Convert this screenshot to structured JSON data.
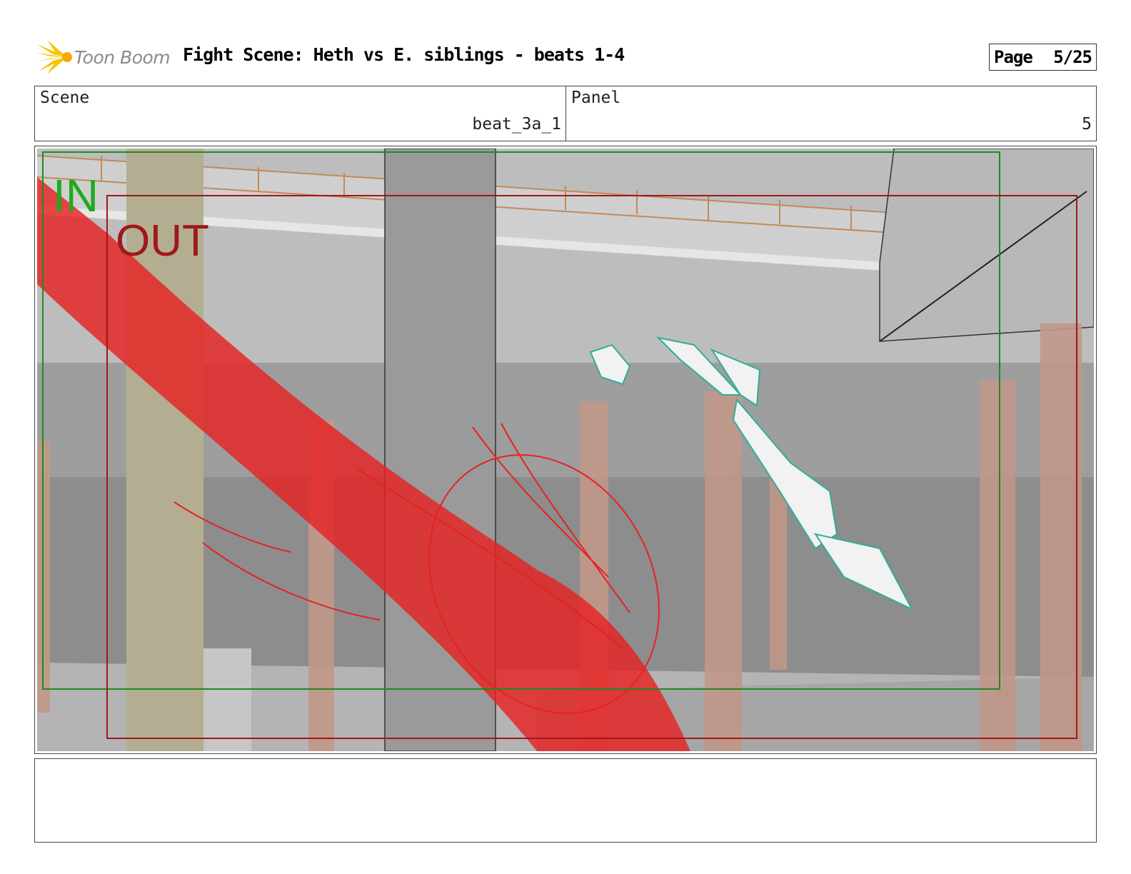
{
  "header": {
    "logo_text": "Toon Boom",
    "title": "Fight Scene: Heth vs E. siblings - beats 1-4",
    "page_label": "Page",
    "page_number": "5/25"
  },
  "info": {
    "scene_label": "Scene",
    "scene_value": "beat_3a_1",
    "panel_label": "Panel",
    "panel_value": "5"
  },
  "panel_image": {
    "in_label": "IN",
    "out_label": "OUT",
    "colors": {
      "in_frame": "#1f8a1f",
      "out_frame": "#a01818",
      "effect": "#e52222",
      "character": "#2fae9a"
    }
  },
  "notes": {
    "text": ""
  }
}
